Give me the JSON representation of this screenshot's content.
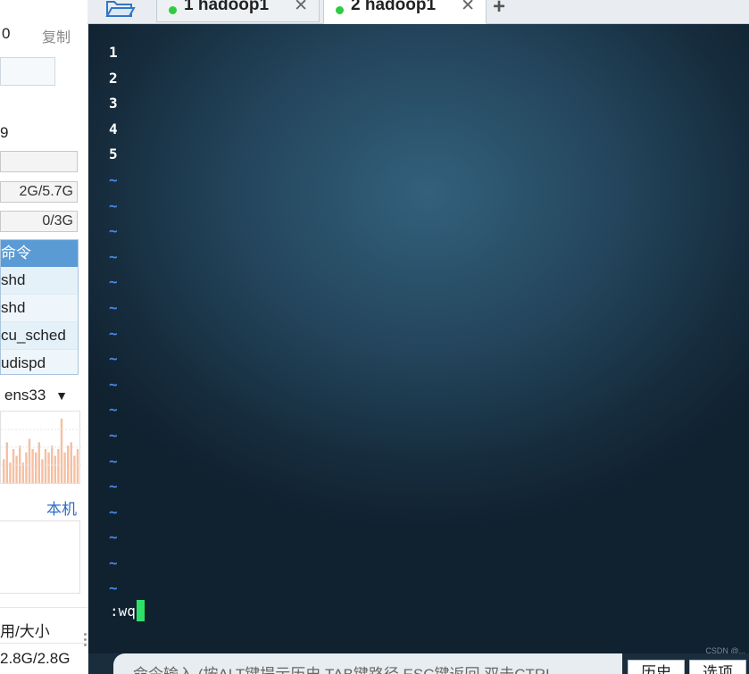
{
  "sidebar": {
    "top_value": "0",
    "copy_label": "复制",
    "value_9": "9",
    "mem_value": "2G/5.7G",
    "swap_value": "0/3G",
    "process_header": "命令",
    "processes": [
      "shd",
      "shd",
      "cu_sched",
      "udispd"
    ],
    "interface_label": "ens33",
    "network_values": [
      0.35,
      0.6,
      0.3,
      0.5,
      0.4,
      0.55,
      0.3,
      0.45,
      0.65,
      0.5,
      0.45,
      0.6,
      0.35,
      0.5,
      0.45,
      0.55,
      0.4,
      0.5,
      0.95,
      0.45,
      0.55,
      0.6,
      0.4,
      0.5
    ],
    "host_link": "本机",
    "disk_header": "用/大小",
    "disk_value": "2.8G/2.8G"
  },
  "tabs": [
    {
      "label": "1 hadoop1",
      "active": false,
      "status_color": "#2ecc40"
    },
    {
      "label": "2 hadoop1",
      "active": true,
      "status_color": "#2ecc40"
    }
  ],
  "terminal": {
    "line_numbers": [
      "1",
      "2",
      "3",
      "4",
      "5"
    ],
    "tilde_count": 17,
    "tilde_char": "~",
    "command": ":wq",
    "cursor_color": "#2ee06a",
    "watermark": "CSDN @..."
  },
  "command_bar": {
    "hint": "命令输入 (按ALT键提示历史,TAB键路径,ESC键返回,双击CTRL",
    "history_label": "历史",
    "options_label": "选项"
  }
}
